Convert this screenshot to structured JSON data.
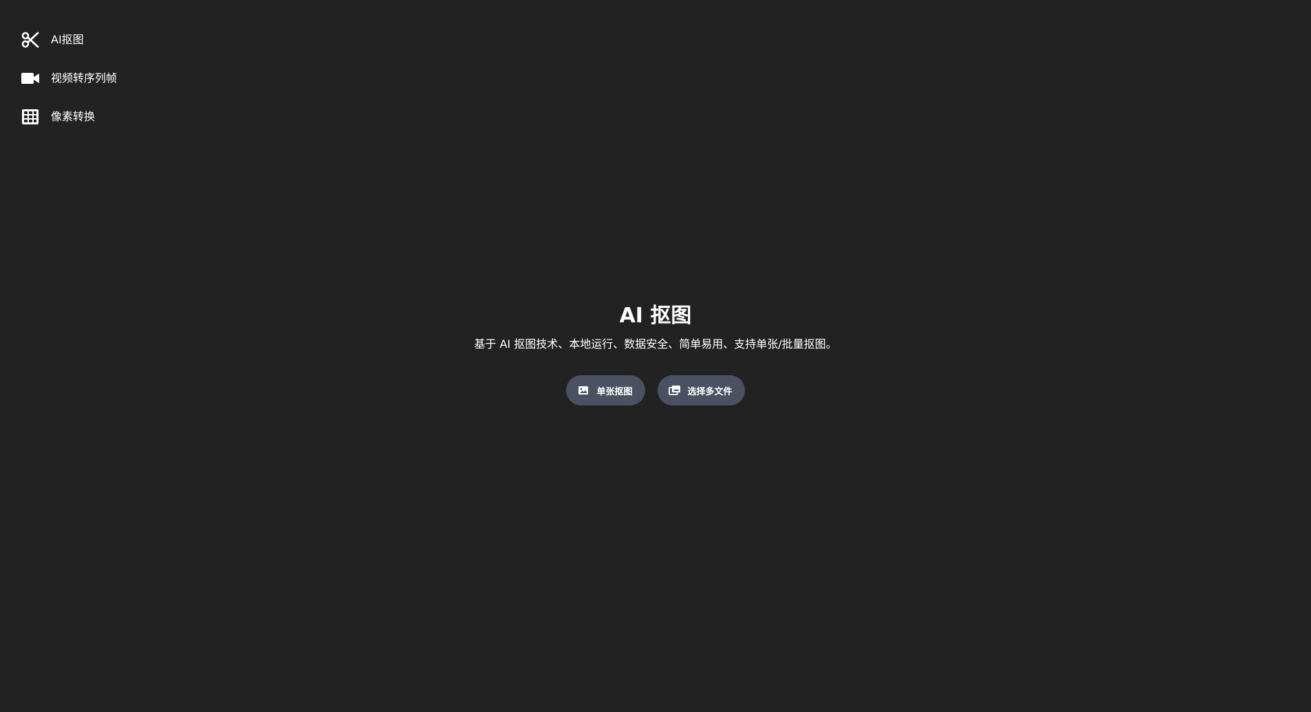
{
  "sidebar": {
    "items": [
      {
        "label": "AI抠图",
        "icon": "scissors-icon"
      },
      {
        "label": "视频转序列帧",
        "icon": "video-camera-icon"
      },
      {
        "label": "像素转换",
        "icon": "grid-icon"
      }
    ]
  },
  "main": {
    "title": "AI 抠图",
    "subtitle": "基于 AI 抠图技术、本地运行、数据安全、简单易用、支持单张/批量抠图。",
    "buttons": [
      {
        "label": "单张抠图",
        "icon": "image-icon"
      },
      {
        "label": "选择多文件",
        "icon": "images-icon"
      }
    ]
  },
  "colors": {
    "background": "#222222",
    "button": "#4a5262",
    "text": "#ffffff"
  }
}
